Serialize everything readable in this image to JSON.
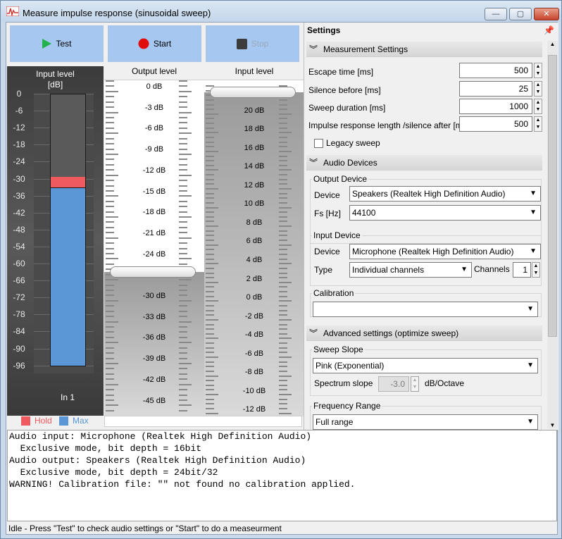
{
  "window": {
    "title": "Measure impulse response (sinusoidal sweep)",
    "min": "—",
    "max": "▢",
    "close": "✕"
  },
  "toolbar": {
    "test": "Test",
    "start": "Start",
    "stop": "Stop"
  },
  "meter": {
    "header_line1": "Input level",
    "header_line2": "[dB]",
    "scale": [
      "0",
      "-6",
      "-12",
      "-18",
      "-24",
      "-30",
      "-36",
      "-42",
      "-48",
      "-54",
      "-60",
      "-66",
      "-72",
      "-78",
      "-84",
      "-90",
      "-96"
    ],
    "hold_db": -29,
    "max_db": -33,
    "channel": "In 1",
    "legend": [
      {
        "label": "Hold",
        "color": "#ef5a5f"
      },
      {
        "label": "Max",
        "color": "#5b96d6"
      }
    ]
  },
  "output_level": {
    "header": "Output level",
    "labels": [
      "0 dB",
      "-3 dB",
      "-6 dB",
      "-9 dB",
      "-12 dB",
      "-15 dB",
      "-18 dB",
      "-21 dB",
      "-24 dB",
      "-27 dB",
      "-30 dB",
      "-33 dB",
      "-36 dB",
      "-39 dB",
      "-42 dB",
      "-45 dB"
    ],
    "value_db": -26.5
  },
  "input_level": {
    "header": "Input level",
    "labels": [
      "22 dB",
      "20 dB",
      "18 dB",
      "16 dB",
      "14 dB",
      "12 dB",
      "10 dB",
      "8 dB",
      "6 dB",
      "4 dB",
      "2 dB",
      "0 dB",
      "-2 dB",
      "-4 dB",
      "-6 dB",
      "-8 dB",
      "-10 dB",
      "-12 dB"
    ],
    "value_db": 22
  },
  "settings": {
    "header": "Settings",
    "measurement_section": "Measurement Settings",
    "escape_time": {
      "label": "Escape time [ms]",
      "value": "500"
    },
    "silence_before": {
      "label": "Silence before [ms]",
      "value": "25"
    },
    "sweep_duration": {
      "label": "Sweep duration [ms]",
      "value": "1000"
    },
    "impulse_length": {
      "label": "Impulse response length /silence after [ms]",
      "value": "500"
    },
    "legacy_sweep": "Legacy sweep",
    "audio_section": "Audio Devices",
    "output_device_group": "Output Device",
    "output_device_label": "Device",
    "output_device_value": "Speakers (Realtek High Definition Audio)",
    "fs_label": "Fs [Hz]",
    "fs_value": "44100",
    "input_device_group": "Input Device",
    "input_device_label": "Device",
    "input_device_value": "Microphone (Realtek High Definition Audio)",
    "type_label": "Type",
    "type_value": "Individual channels",
    "channels_label": "Channels",
    "channels_value": "1",
    "calibration_group": "Calibration",
    "calibration_value": "",
    "advanced_section": "Advanced settings (optimize sweep)",
    "sweep_slope_group": "Sweep Slope",
    "sweep_slope_value": "Pink (Exponential)",
    "spectrum_slope_label": "Spectrum slope",
    "spectrum_slope_value": "-3.0",
    "spectrum_slope_unit": "dB/Octave",
    "frequency_range_group": "Frequency Range",
    "frequency_range_value": "Full range"
  },
  "log": {
    "lines": [
      "Audio input: Microphone (Realtek High Definition Audio)",
      "  Exclusive mode, bit depth = 16bit",
      "Audio output: Speakers (Realtek High Definition Audio)",
      "  Exclusive mode, bit depth = 24bit/32",
      "WARNING! Calibration file: \"\" not found no calibration applied."
    ]
  },
  "status": "Idle - Press \"Test\" to check audio settings or \"Start\" to do a measeurment"
}
